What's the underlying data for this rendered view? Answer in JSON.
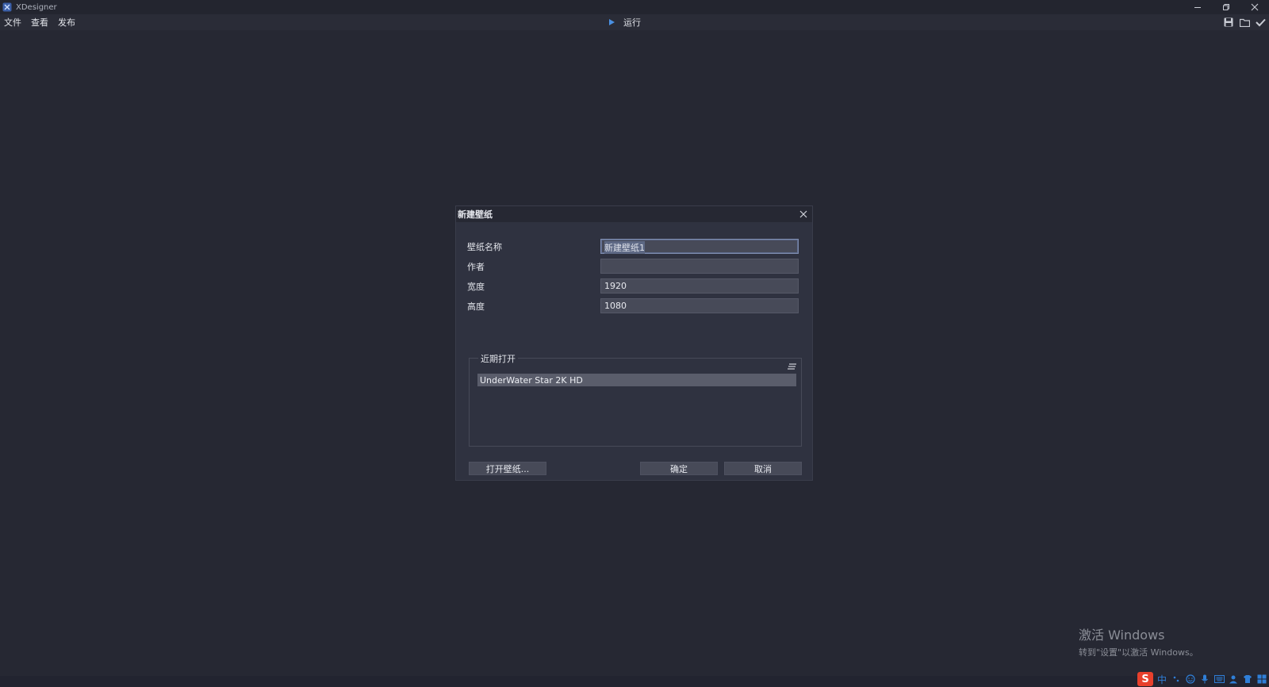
{
  "window": {
    "title": "XDesigner",
    "controls": [
      "minimize",
      "restore",
      "close"
    ]
  },
  "menubar": {
    "items": [
      "文件",
      "查看",
      "发布"
    ],
    "run_label": "运行",
    "toolbar_icons": [
      "save-icon",
      "folder-icon",
      "checkmark-icon"
    ]
  },
  "dialog": {
    "title": "新建壁纸",
    "fields": {
      "name_label": "壁纸名称",
      "name_value": "新建壁纸1",
      "author_label": "作者",
      "author_value": "",
      "width_label": "宽度",
      "width_value": "1920",
      "height_label": "高度",
      "height_value": "1080"
    },
    "recent": {
      "legend": "近期打开",
      "items": [
        "UnderWater Star 2K HD"
      ]
    },
    "buttons": {
      "open": "打开壁纸...",
      "ok": "确定",
      "cancel": "取消"
    }
  },
  "watermark": {
    "line1": "激活 Windows",
    "line2": "转到\"设置\"以激活 Windows。"
  },
  "tray": {
    "ime_label": "S",
    "ime_lang": "中"
  },
  "colors": {
    "background": "#262833",
    "dialog_bg": "#2f3240",
    "input_bg": "#474a58",
    "accent": "#4a90e2"
  }
}
